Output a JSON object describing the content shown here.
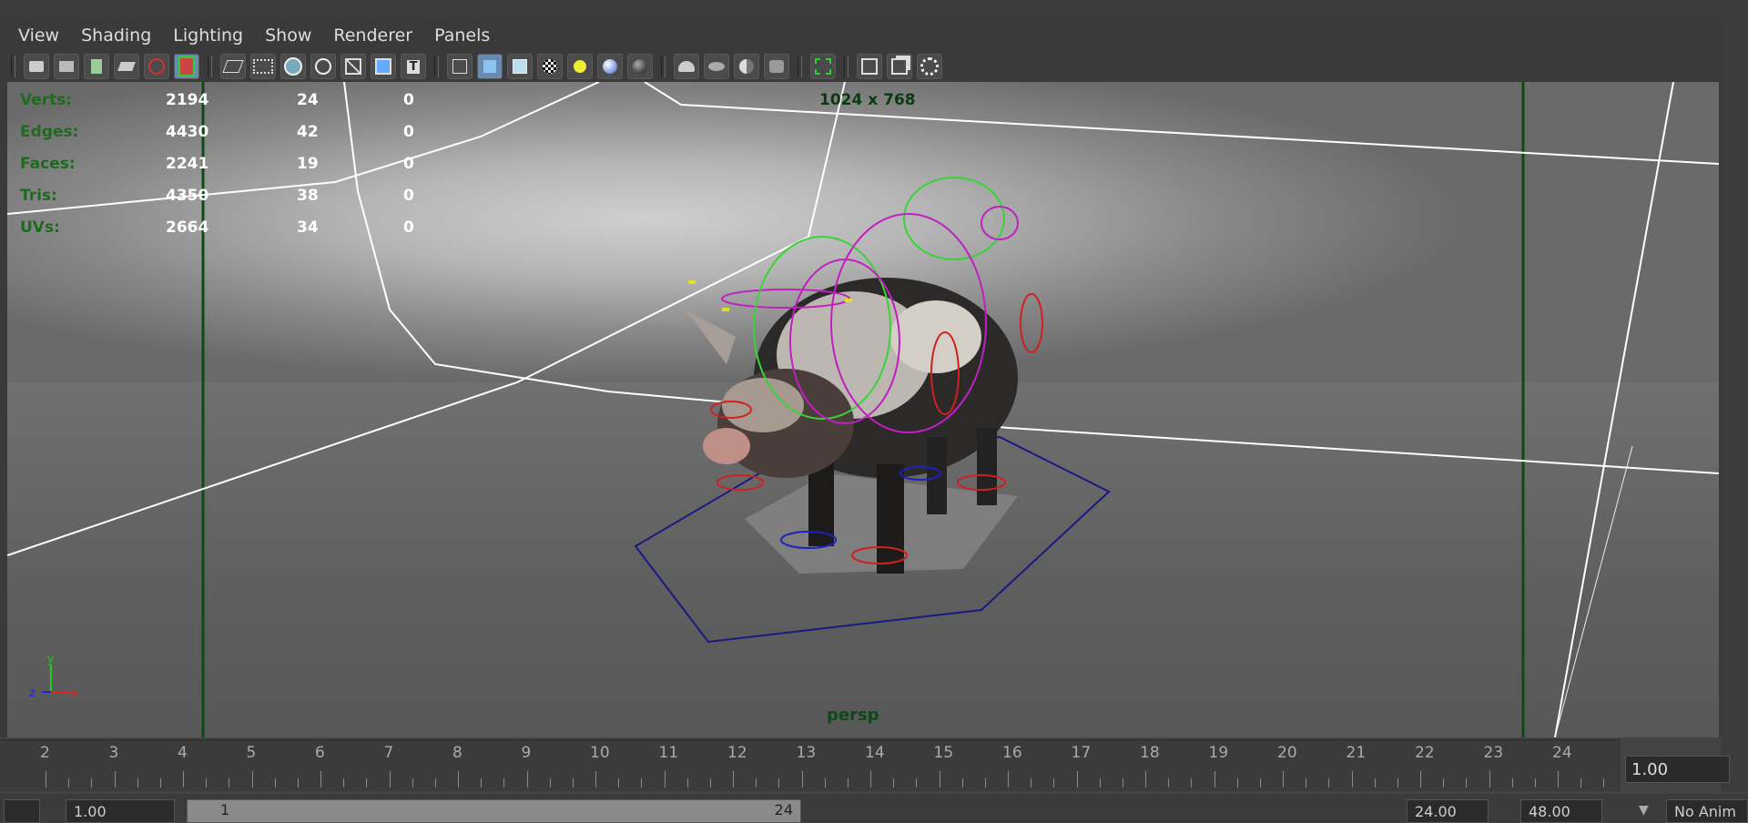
{
  "menu": [
    "View",
    "Shading",
    "Lighting",
    "Show",
    "Renderer",
    "Panels"
  ],
  "toolbar_icons": [
    "camera-icon",
    "camera-attr-icon",
    "bookmark-icon",
    "image-plane-icon",
    "grid-icon",
    "film-gate-icon",
    "wireframe-icon",
    "film-icon",
    "sphere-shade-icon",
    "circle-icon",
    "xray-icon",
    "xray-joints-icon",
    "text-icon",
    "cube-wire-icon",
    "cube-smooth-icon",
    "cube-textured-icon",
    "checker-icon",
    "light-icon",
    "shaded-sphere-icon",
    "dark-sphere-icon",
    "lights-icon",
    "shadow-icon",
    "isolate-icon",
    "highlight-icon",
    "select-icon",
    "cube-icon",
    "isolate-select-icon",
    "share-icon"
  ],
  "hud": {
    "rows": [
      {
        "label": "Verts:",
        "v1": "2194",
        "v2": "24",
        "v3": "0"
      },
      {
        "label": "Edges:",
        "v1": "4430",
        "v2": "42",
        "v3": "0"
      },
      {
        "label": "Faces:",
        "v1": "2241",
        "v2": "19",
        "v3": "0"
      },
      {
        "label": "Tris:",
        "v1": "4350",
        "v2": "38",
        "v3": "0"
      },
      {
        "label": "UVs:",
        "v1": "2664",
        "v2": "34",
        "v3": "0"
      }
    ]
  },
  "resolution": "1024 x 768",
  "camera": "persp",
  "axis": {
    "x": "x",
    "y": "y",
    "z": "z"
  },
  "timeline": {
    "frames": [
      "2",
      "3",
      "4",
      "5",
      "6",
      "7",
      "8",
      "9",
      "10",
      "11",
      "12",
      "13",
      "14",
      "15",
      "16",
      "17",
      "18",
      "19",
      "20",
      "21",
      "22",
      "23",
      "24"
    ],
    "current_time": "1.00"
  },
  "range": {
    "start": "1.00",
    "slider_start": "1",
    "slider_end": "24",
    "end": "24.00",
    "max": "48.00",
    "anim_layer": "No Anim"
  }
}
